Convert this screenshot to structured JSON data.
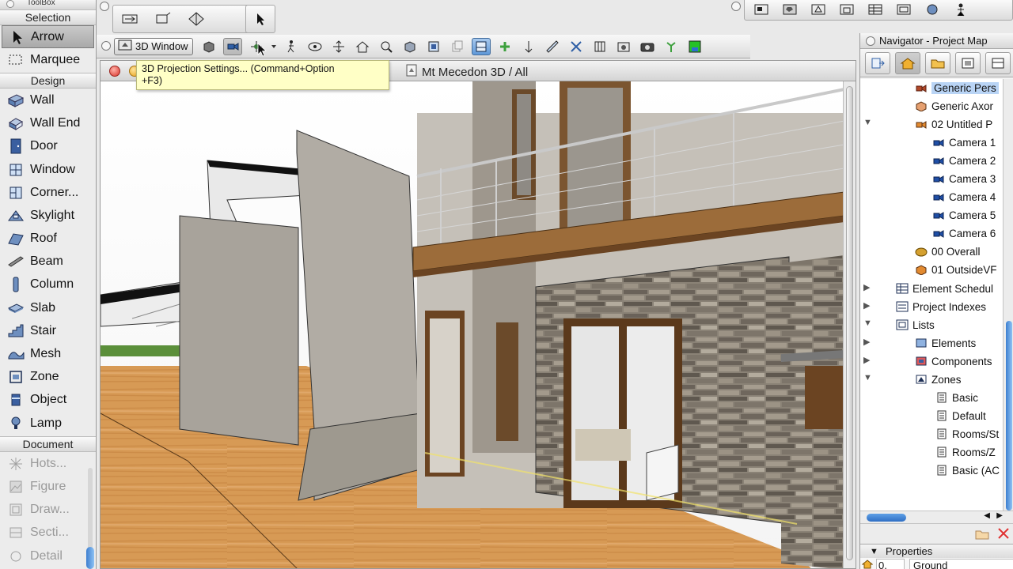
{
  "toolbox": {
    "window_title": "ToolBox",
    "sections": {
      "selection": "Selection",
      "design": "Design",
      "document": "Document"
    },
    "selection_items": [
      {
        "label": "Arrow",
        "icon": "arrow-icon"
      },
      {
        "label": "Marquee",
        "icon": "marquee-icon"
      }
    ],
    "design_items": [
      {
        "label": "Wall",
        "icon": "wall-icon"
      },
      {
        "label": "Wall End",
        "icon": "wall-end-icon"
      },
      {
        "label": "Door",
        "icon": "door-icon"
      },
      {
        "label": "Window",
        "icon": "window-icon"
      },
      {
        "label": "Corner...",
        "icon": "corner-window-icon"
      },
      {
        "label": "Skylight",
        "icon": "skylight-icon"
      },
      {
        "label": "Roof",
        "icon": "roof-icon"
      },
      {
        "label": "Beam",
        "icon": "beam-icon"
      },
      {
        "label": "Column",
        "icon": "column-icon"
      },
      {
        "label": "Slab",
        "icon": "slab-icon"
      },
      {
        "label": "Stair",
        "icon": "stair-icon"
      },
      {
        "label": "Mesh",
        "icon": "mesh-icon"
      },
      {
        "label": "Zone",
        "icon": "zone-icon"
      },
      {
        "label": "Object",
        "icon": "object-icon"
      },
      {
        "label": "Lamp",
        "icon": "lamp-icon"
      }
    ],
    "document_items": [
      {
        "label": "Hots...",
        "icon": "hotspot-icon"
      },
      {
        "label": "Figure",
        "icon": "figure-icon"
      },
      {
        "label": "Draw...",
        "icon": "drawing-icon"
      },
      {
        "label": "Secti...",
        "icon": "section-icon"
      },
      {
        "label": "Detail",
        "icon": "detail-icon"
      }
    ]
  },
  "toolbar_3d": {
    "window_button_label": "3D Window",
    "tooltip_line1": "3D Projection Settings... (Command+Option",
    "tooltip_line2": "+F3)"
  },
  "window_3d": {
    "title": "Mt Mecedon 3D / All"
  },
  "navigator": {
    "title": "Navigator - Project Map",
    "tree": [
      {
        "label": "Generic Pers",
        "selected": true
      },
      {
        "label": "Generic Axor"
      },
      {
        "label": "02 Untitled P"
      },
      {
        "label": "Camera 1"
      },
      {
        "label": "Camera 2"
      },
      {
        "label": "Camera 3"
      },
      {
        "label": "Camera 4"
      },
      {
        "label": "Camera 5"
      },
      {
        "label": "Camera 6"
      },
      {
        "label": "00 Overall"
      },
      {
        "label": "01 OutsideVF"
      },
      {
        "label": "Element Schedul"
      },
      {
        "label": "Project Indexes"
      },
      {
        "label": "Lists"
      },
      {
        "label": "Elements"
      },
      {
        "label": "Components"
      },
      {
        "label": "Zones"
      },
      {
        "label": "Basic"
      },
      {
        "label": "Default"
      },
      {
        "label": "Rooms/St"
      },
      {
        "label": "Rooms/Z"
      },
      {
        "label": "Basic (AC"
      }
    ],
    "properties_title": "Properties",
    "properties_value": "0.",
    "properties_story": "Ground"
  },
  "colors": {
    "selection_blue": "#b9d4f5",
    "accent_blue": "#3d7fd0",
    "tooltip_yellow": "#ffffc6",
    "floor_wood": "#d79a55"
  }
}
